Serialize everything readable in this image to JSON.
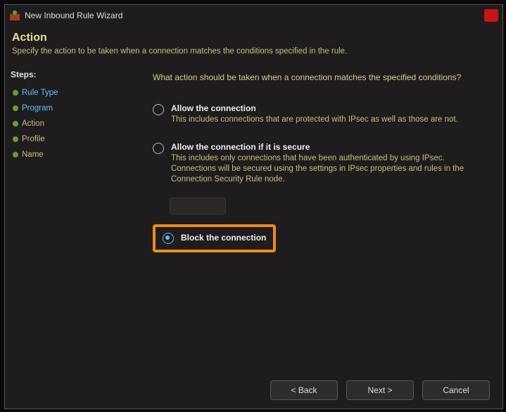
{
  "titlebar": {
    "title": "New Inbound Rule Wizard"
  },
  "header": {
    "title": "Action",
    "subtitle": "Specify the action to be taken when a connection matches the conditions specified in the rule."
  },
  "steps": {
    "label": "Steps:",
    "items": [
      {
        "label": "Rule Type",
        "state": "done"
      },
      {
        "label": "Program",
        "state": "done"
      },
      {
        "label": "Action",
        "state": "active"
      },
      {
        "label": "Profile",
        "state": "pending"
      },
      {
        "label": "Name",
        "state": "pending"
      }
    ]
  },
  "content": {
    "question": "What action should be taken when a connection matches the specified conditions?",
    "options": [
      {
        "title": "Allow the connection",
        "desc": "This includes connections that are protected with IPsec as well as those are not.",
        "selected": false
      },
      {
        "title": "Allow the connection if it is secure",
        "desc": "This includes only connections that have been authenticated by using IPsec.  Connections will be secured using the settings in IPsec properties and rules in the Connection Security Rule node.",
        "selected": false
      },
      {
        "title": "Block the connection",
        "desc": "",
        "selected": true
      }
    ]
  },
  "footer": {
    "back": "< Back",
    "next": "Next >",
    "cancel": "Cancel"
  }
}
